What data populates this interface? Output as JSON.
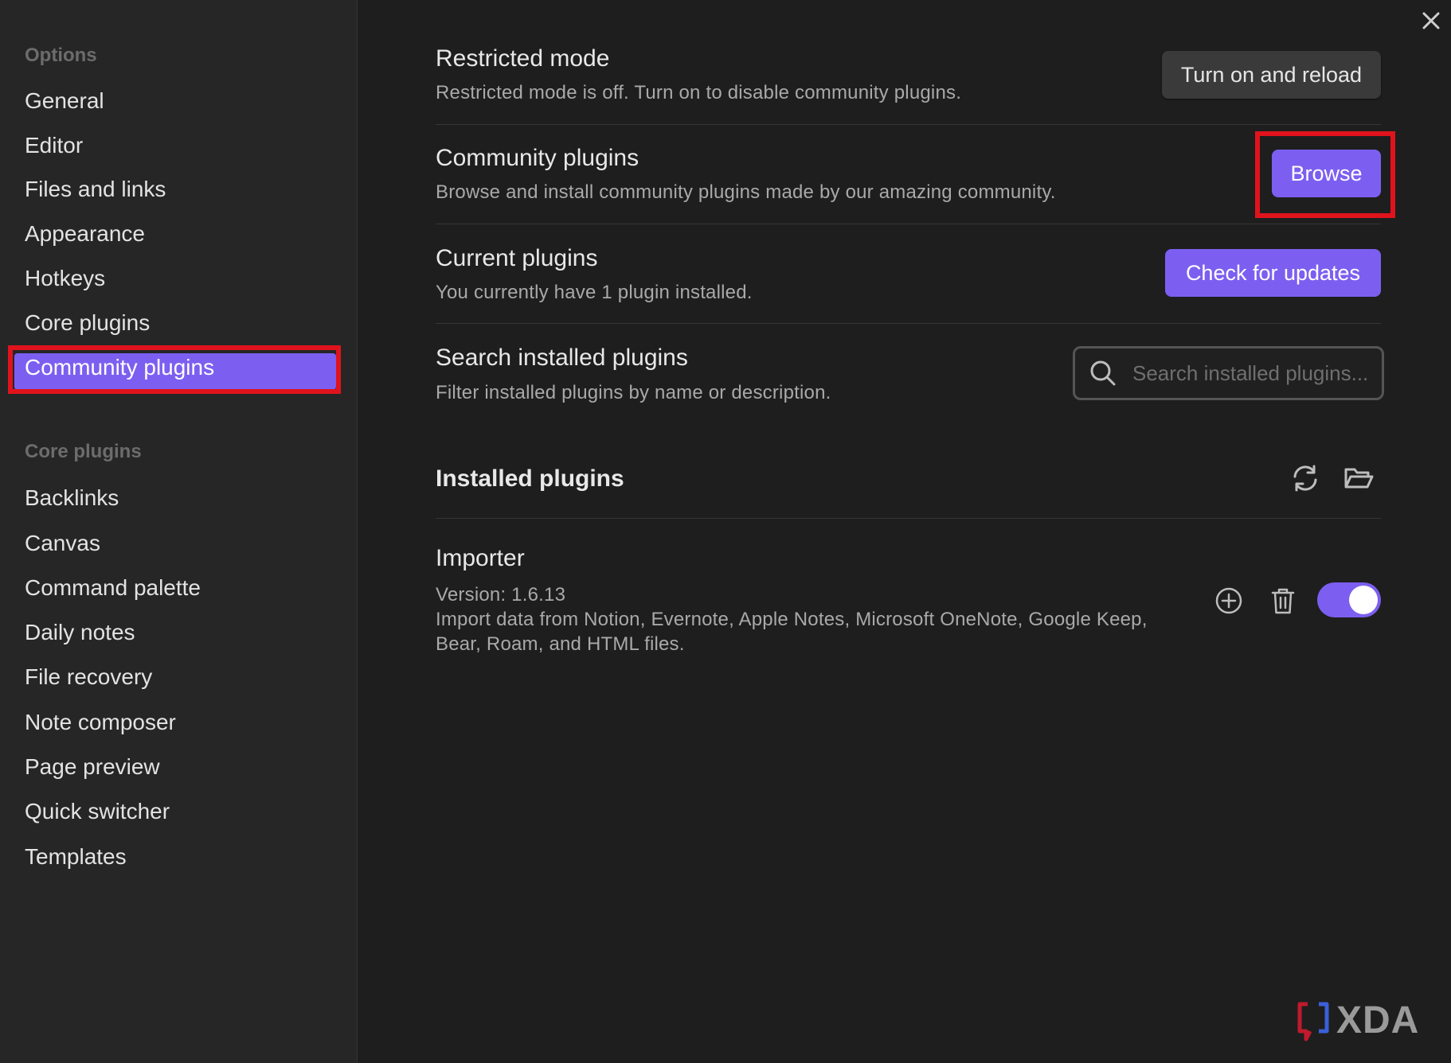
{
  "sidebar": {
    "options_title": "Options",
    "options_items": [
      {
        "label": "General"
      },
      {
        "label": "Editor"
      },
      {
        "label": "Files and links"
      },
      {
        "label": "Appearance"
      },
      {
        "label": "Hotkeys"
      },
      {
        "label": "Core plugins"
      },
      {
        "label": "Community plugins"
      }
    ],
    "core_title": "Core plugins",
    "core_items": [
      {
        "label": "Backlinks"
      },
      {
        "label": "Canvas"
      },
      {
        "label": "Command palette"
      },
      {
        "label": "Daily notes"
      },
      {
        "label": "File recovery"
      },
      {
        "label": "Note composer"
      },
      {
        "label": "Page preview"
      },
      {
        "label": "Quick switcher"
      },
      {
        "label": "Templates"
      }
    ],
    "active_item": "Community plugins"
  },
  "settings": {
    "restricted": {
      "title": "Restricted mode",
      "desc": "Restricted mode is off. Turn on to disable community plugins.",
      "button": "Turn on and reload"
    },
    "community": {
      "title": "Community plugins",
      "desc": "Browse and install community plugins made by our amazing community.",
      "button": "Browse"
    },
    "current": {
      "title": "Current plugins",
      "desc": "You currently have 1 plugin installed.",
      "button": "Check for updates"
    },
    "search": {
      "title": "Search installed plugins",
      "desc": "Filter installed plugins by name or description.",
      "placeholder": "Search installed plugins..."
    }
  },
  "installed": {
    "heading": "Installed plugins",
    "plugins": [
      {
        "name": "Importer",
        "version": "Version: 1.6.13",
        "desc_line1": "Import data from Notion, Evernote, Apple Notes, Microsoft OneNote, Google Keep,",
        "desc_line2": "Bear, Roam, and HTML files.",
        "enabled": true
      }
    ]
  },
  "watermark": "XDA",
  "colors": {
    "accent": "#7c5ff0",
    "highlight": "#e0131d",
    "background": "#1e1e1e",
    "sidebar": "#262626"
  }
}
